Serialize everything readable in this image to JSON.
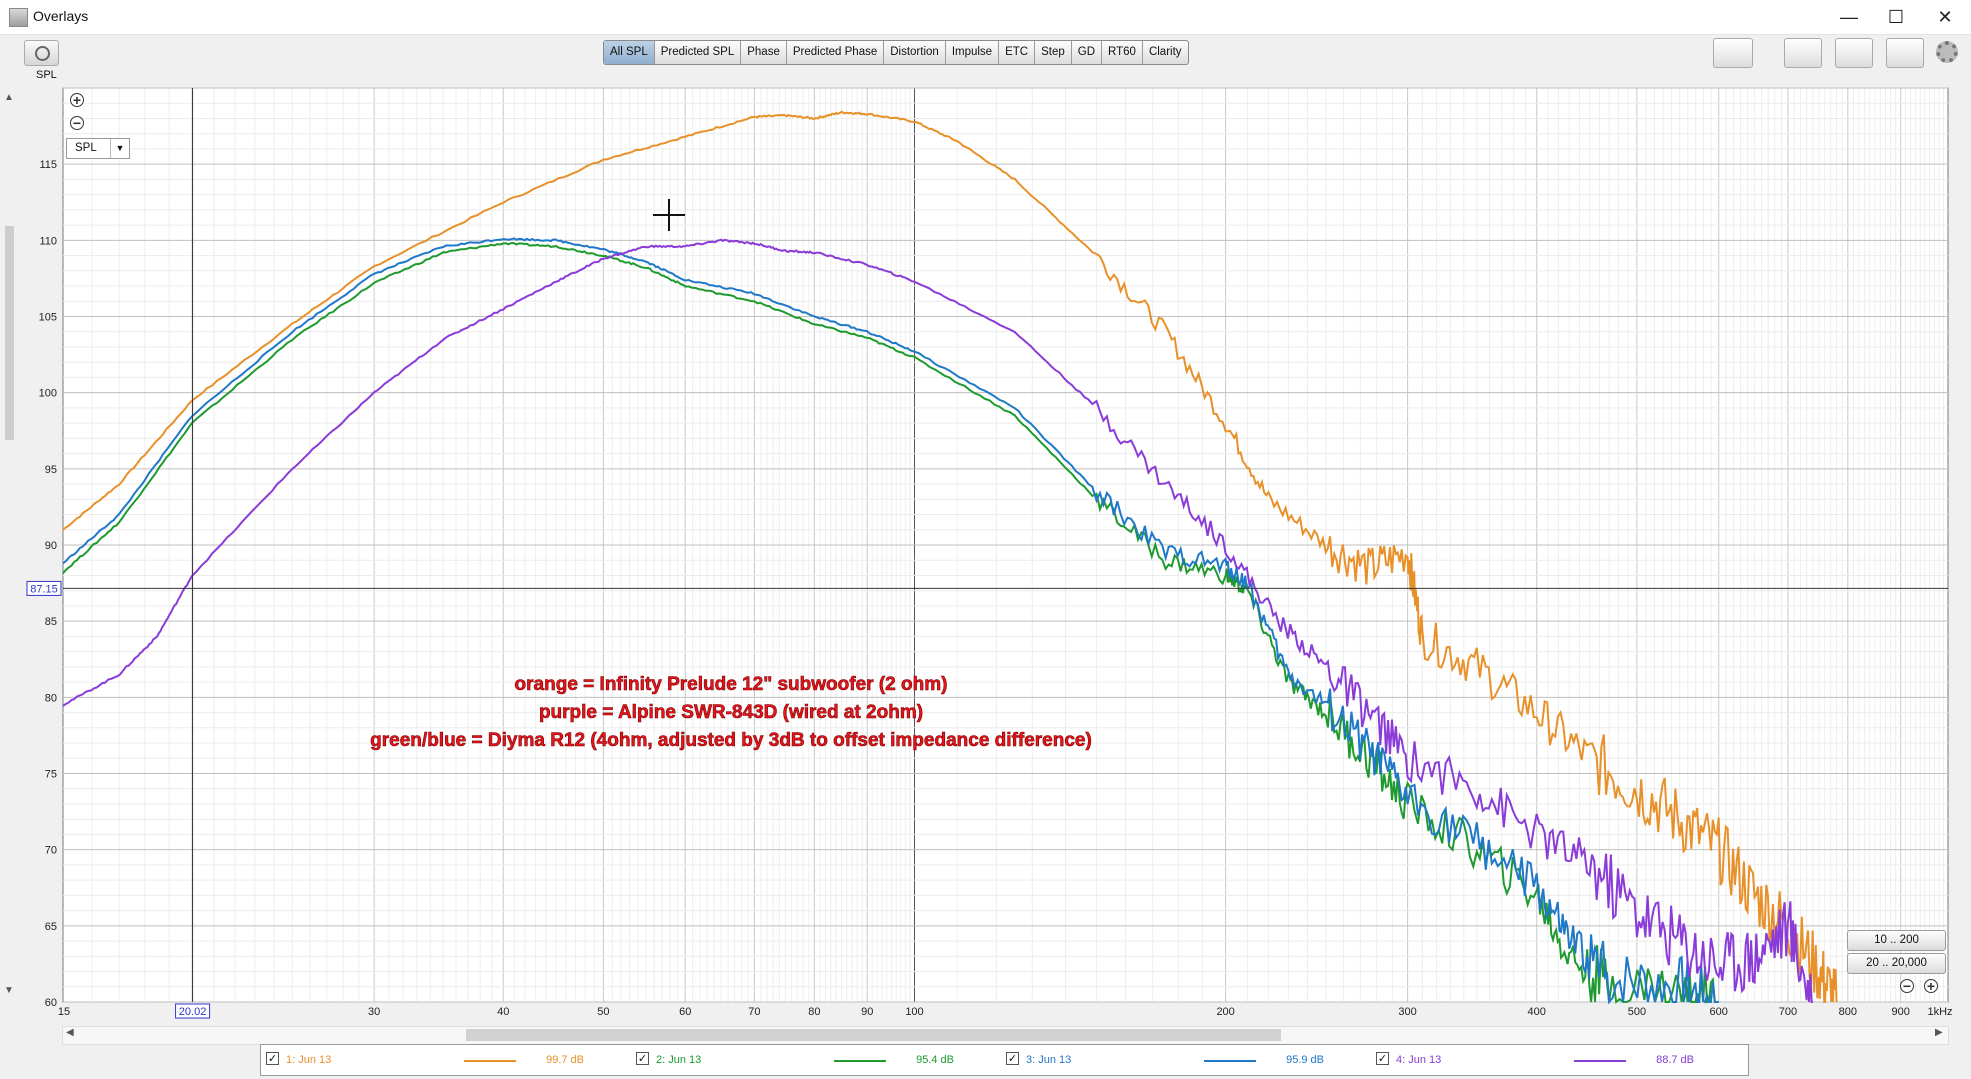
{
  "window": {
    "title": "Overlays",
    "minimize": "—",
    "maximize": "☐",
    "close": "✕"
  },
  "toolbar": {
    "spl_caption": "SPL",
    "tabs": [
      "All SPL",
      "Predicted SPL",
      "Phase",
      "Predicted Phase",
      "Distortion",
      "Impulse",
      "ETC",
      "Step",
      "GD",
      "RT60",
      "Clarity"
    ],
    "active_tab": "All SPL",
    "icons": [
      "camera-icon",
      "legend-toggle-icon",
      "graph-controls-icon",
      "layout-icon",
      "fit-to-window-icon",
      "gear-icon"
    ]
  },
  "plot_controls": {
    "zoom_in": "+",
    "zoom_out": "−",
    "measure_select": "SPL",
    "range_buttons": [
      "10 .. 200",
      "20 .. 20,000"
    ]
  },
  "cursor": {
    "x_readout": "20.02",
    "y_readout": "87.15",
    "x_value": 20.02,
    "y_value": 87.15
  },
  "annotation": [
    "orange = Infinity Prelude 12\" subwoofer (2 ohm)",
    "purple = Alpine SWR-843D (wired at 2ohm)",
    "green/blue = Diyma R12 (4ohm, adjusted by 3dB to offset impedance difference)"
  ],
  "annotation_color": "#e8141b",
  "chart_data": {
    "type": "line",
    "x_scale": "log",
    "xlim": [
      15,
      1000
    ],
    "ylim": [
      60,
      120
    ],
    "x_ticks": [
      15,
      20.02,
      30,
      40,
      50,
      60,
      70,
      80,
      90,
      100,
      200,
      300,
      400,
      500,
      600,
      700,
      800,
      900,
      1000
    ],
    "x_tick_labels": [
      "15",
      "20.02",
      "30",
      "40",
      "50",
      "60",
      "70",
      "80",
      "90",
      "100",
      "200",
      "300",
      "400",
      "500",
      "600",
      "700",
      "800",
      "900",
      "1kHz"
    ],
    "y_ticks": [
      60,
      65,
      70,
      75,
      80,
      85,
      87.15,
      90,
      95,
      100,
      105,
      110,
      115
    ],
    "y_tick_labels": [
      "60",
      "65",
      "70",
      "75",
      "80",
      "85",
      "87.15",
      "90",
      "95",
      "100",
      "105",
      "110",
      "115"
    ],
    "grid": true,
    "series": [
      {
        "name": "1: Jun 13",
        "color": "#e8912a",
        "level": "99.7 dB",
        "points": [
          [
            15,
            91
          ],
          [
            17,
            94
          ],
          [
            20,
            99.5
          ],
          [
            25,
            104.5
          ],
          [
            30,
            108.3
          ],
          [
            40,
            112.5
          ],
          [
            50,
            115.3
          ],
          [
            60,
            116.8
          ],
          [
            70,
            118.1
          ],
          [
            75,
            118.2
          ],
          [
            80,
            118
          ],
          [
            85,
            118.4
          ],
          [
            90,
            118.3
          ],
          [
            100,
            117.8
          ],
          [
            110,
            116.5
          ],
          [
            125,
            114
          ],
          [
            150,
            109
          ],
          [
            175,
            104
          ],
          [
            200,
            98
          ],
          [
            220,
            93
          ],
          [
            250,
            90
          ],
          [
            275,
            88.5
          ],
          [
            300,
            89.5
          ],
          [
            310,
            84
          ],
          [
            350,
            82
          ],
          [
            400,
            79
          ],
          [
            450,
            76
          ],
          [
            500,
            74
          ],
          [
            550,
            72
          ],
          [
            600,
            70
          ],
          [
            650,
            67
          ],
          [
            700,
            65
          ],
          [
            750,
            62
          ],
          [
            780,
            60
          ]
        ]
      },
      {
        "name": "2: Jun 13",
        "color": "#1e9a2e",
        "level": "95.4 dB",
        "points": [
          [
            15,
            88.2
          ],
          [
            17,
            91.5
          ],
          [
            20,
            98
          ],
          [
            25,
            103.5
          ],
          [
            30,
            107.2
          ],
          [
            35,
            109.2
          ],
          [
            40,
            109.8
          ],
          [
            45,
            109.6
          ],
          [
            50,
            109
          ],
          [
            55,
            108.2
          ],
          [
            60,
            107
          ],
          [
            70,
            106
          ],
          [
            80,
            104.5
          ],
          [
            90,
            103.6
          ],
          [
            100,
            102.3
          ],
          [
            125,
            98.5
          ],
          [
            150,
            93
          ],
          [
            175,
            89
          ],
          [
            200,
            88
          ],
          [
            210,
            87
          ],
          [
            230,
            81
          ],
          [
            250,
            79
          ],
          [
            275,
            76
          ],
          [
            300,
            73
          ],
          [
            350,
            70
          ],
          [
            400,
            67
          ],
          [
            430,
            63
          ],
          [
            470,
            61
          ],
          [
            550,
            60.5
          ],
          [
            600,
            60
          ]
        ]
      },
      {
        "name": "3: Jun 13",
        "color": "#1f78c8",
        "level": "95.9 dB",
        "points": [
          [
            15,
            88.8
          ],
          [
            17,
            92
          ],
          [
            20,
            98.5
          ],
          [
            25,
            104
          ],
          [
            30,
            107.8
          ],
          [
            35,
            109.6
          ],
          [
            40,
            110.1
          ],
          [
            45,
            110
          ],
          [
            50,
            109.4
          ],
          [
            55,
            108.6
          ],
          [
            60,
            107.4
          ],
          [
            70,
            106.5
          ],
          [
            80,
            105
          ],
          [
            90,
            104
          ],
          [
            100,
            102.7
          ],
          [
            125,
            99
          ],
          [
            150,
            93.5
          ],
          [
            175,
            89.5
          ],
          [
            200,
            88.6
          ],
          [
            210,
            87.5
          ],
          [
            230,
            81.5
          ],
          [
            250,
            79.5
          ],
          [
            275,
            76.5
          ],
          [
            300,
            73.5
          ],
          [
            350,
            70.5
          ],
          [
            400,
            67.5
          ],
          [
            430,
            64
          ],
          [
            470,
            61.5
          ],
          [
            550,
            61
          ],
          [
            600,
            60
          ]
        ]
      },
      {
        "name": "4: Jun 13",
        "color": "#8a3bd8",
        "level": "88.7 dB",
        "points": [
          [
            15,
            79.5
          ],
          [
            17,
            81.5
          ],
          [
            18.5,
            84
          ],
          [
            20,
            88
          ],
          [
            25,
            95
          ],
          [
            30,
            100
          ],
          [
            35,
            103.5
          ],
          [
            40,
            105.5
          ],
          [
            45,
            107.3
          ],
          [
            50,
            108.8
          ],
          [
            55,
            109.6
          ],
          [
            60,
            109.6
          ],
          [
            65,
            110
          ],
          [
            70,
            109.8
          ],
          [
            75,
            109.3
          ],
          [
            80,
            109.2
          ],
          [
            90,
            108.4
          ],
          [
            100,
            107.3
          ],
          [
            125,
            104
          ],
          [
            150,
            99
          ],
          [
            175,
            94
          ],
          [
            200,
            90
          ],
          [
            225,
            85
          ],
          [
            250,
            82
          ],
          [
            275,
            79
          ],
          [
            300,
            76
          ],
          [
            350,
            74
          ],
          [
            400,
            71
          ],
          [
            450,
            69
          ],
          [
            500,
            66
          ],
          [
            550,
            64
          ],
          [
            600,
            62.5
          ],
          [
            650,
            63
          ],
          [
            700,
            65
          ],
          [
            740,
            60
          ]
        ]
      }
    ]
  }
}
